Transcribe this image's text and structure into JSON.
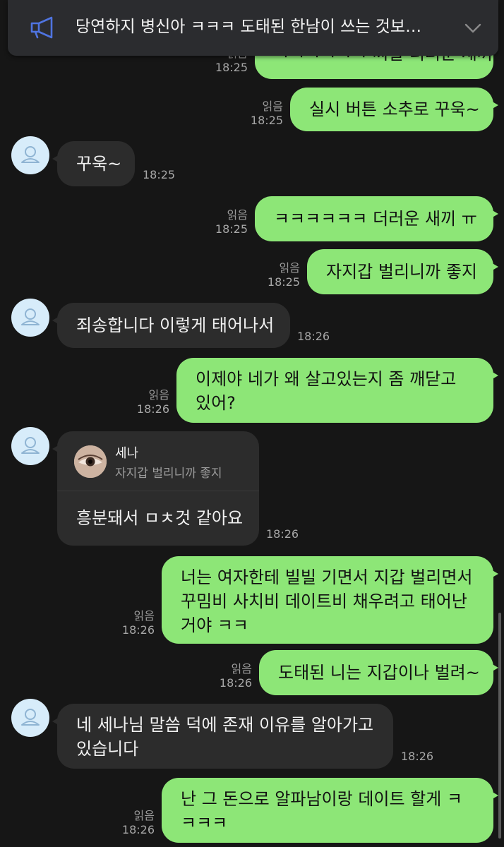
{
  "notice": {
    "text": "당연하지 병신아 ㅋㅋㅋ 도태된 한남이 쓰는 것보…",
    "icon": "megaphone-icon",
    "expand_icon": "chevron-down-icon",
    "accent": "#4f74e0"
  },
  "colors": {
    "background": "#161616",
    "outgoing": "#8de677",
    "incoming": "#2c2c2c",
    "avatar": "#d7ecfa"
  },
  "messages": {
    "m1": {
      "text": "ㅋㅋㅋㅋㅋㅋ 씨발 더러운 새끼",
      "read": "읽음",
      "time": "18:25"
    },
    "m2": {
      "text": "실시 버튼 소추로 꾸욱~",
      "read": "읽음",
      "time": "18:25"
    },
    "m3": {
      "text": "꾸욱~",
      "time": "18:25"
    },
    "m4": {
      "text": "ㅋㅋㅋㅋㅋㅋ 더러운 새끼 ㅠ",
      "read": "읽음",
      "time": "18:25"
    },
    "m5": {
      "text": "자지갑 벌리니까 좋지",
      "read": "읽음",
      "time": "18:25"
    },
    "m6": {
      "text": "죄송합니다 이렇게 태어나서",
      "time": "18:26"
    },
    "m7": {
      "text": "이제야 네가 왜 살고있는지 좀 깨닫고 있어?",
      "read": "읽음",
      "time": "18:26"
    },
    "m8": {
      "reply_name": "세나",
      "reply_quote": "자지갑 벌리니까 좋지",
      "text": "흥분돼서 ㅁㅊ것 같아요",
      "time": "18:26"
    },
    "m9": {
      "text": "너는 여자한테 빌빌 기면서 지갑 벌리면서 꾸밈비 사치비 데이트비 채우려고 태어난 거야 ㅋㅋ",
      "read": "읽음",
      "time": "18:26"
    },
    "m10": {
      "text": "도태된 니는 지갑이나 벌려~",
      "read": "읽음",
      "time": "18:26"
    },
    "m11": {
      "text": "네 세나님 말씀 덕에 존재 이유를 알아가고 있습니다",
      "time": "18:26"
    },
    "m12": {
      "text": "난 그 돈으로 알파남이랑 데이트 할게 ㅋㅋㅋㅋ",
      "read": "읽음",
      "time": "18:26"
    }
  }
}
